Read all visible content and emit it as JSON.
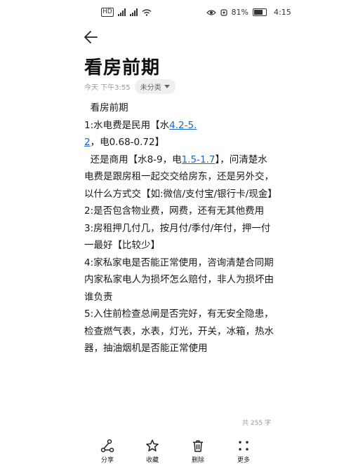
{
  "status_bar": {
    "left_text": "HD",
    "battery": "81%",
    "time": "4:15"
  },
  "note": {
    "title": "看房前期",
    "timestamp": "今天 下午3:55",
    "category": "未分类",
    "paragraphs": [
      [
        {
          "t": "  看房前期"
        }
      ],
      [
        {
          "t": "1:水电费是民用【水"
        },
        {
          "t": "4.2-5.2",
          "link": true
        },
        {
          "t": "，电0.68-0.72】"
        }
      ],
      [
        {
          "t": "  还是商用【水8-9，电"
        },
        {
          "t": "1.5-1.7",
          "link": true
        },
        {
          "t": "】，问清楚水电费是跟房租一起交交给房东，还是另外交，以什么方式交【如:微信/支付宝/银行卡/现金】"
        }
      ],
      [
        {
          "t": "2:是否包含物业费，网费，还有无其他费用"
        }
      ],
      [
        {
          "t": "3:房租押几付几，按月付/季付/年付，押一付一最好【比较少】"
        }
      ],
      [
        {
          "t": "4:家私家电是否能正常使用，咨询清楚合同期内家私家电人为损坏怎么赔付，非人为损坏由谁负责"
        }
      ],
      [
        {
          "t": "5:入住前检查总闸是否完好，有无安全隐患，检查燃气表，水表，灯光，开关，冰箱，热水器，抽油烟机是否能正常使用"
        }
      ]
    ],
    "word_count": "共 255 字"
  },
  "bottom_bar": {
    "share": "分享",
    "favorite": "收藏",
    "delete": "删除",
    "more": "更多"
  }
}
